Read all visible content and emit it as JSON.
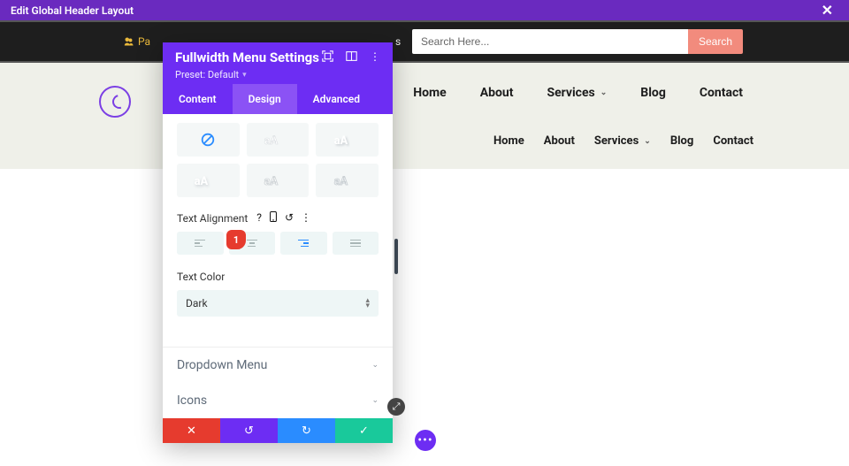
{
  "global_bar": {
    "title": "Edit Global Header Layout"
  },
  "dark_bar": {
    "pause_label": "Pa",
    "letter": "s",
    "search_placeholder": "Search Here...",
    "search_button": "Search"
  },
  "nav1": [
    "Home",
    "About",
    "Services",
    "Blog",
    "Contact"
  ],
  "nav2": [
    "Home",
    "About",
    "Services",
    "Blog",
    "Contact"
  ],
  "panel": {
    "title": "Fullwidth Menu Settings",
    "preset_label": "Preset: Default",
    "tabs": {
      "content": "Content",
      "design": "Design",
      "advanced": "Advanced"
    },
    "text_alignment_label": "Text Alignment",
    "badge": "1",
    "text_color_label": "Text Color",
    "text_color_value": "Dark",
    "accordion": {
      "dropdown": "Dropdown Menu",
      "icons": "Icons"
    }
  }
}
